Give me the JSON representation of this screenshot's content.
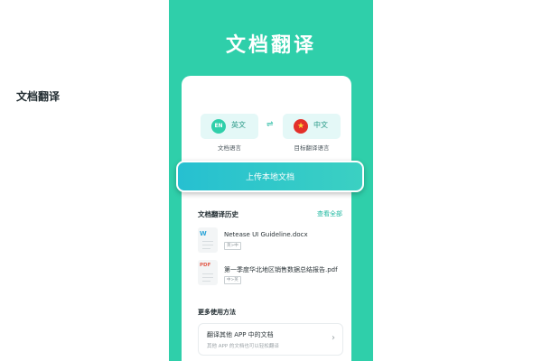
{
  "hero": {
    "title": "文档翻译"
  },
  "card": {
    "title": "文档翻译"
  },
  "source_lang": {
    "badge": "EN",
    "label": "英文",
    "caption": "文档语言"
  },
  "swap": {
    "glyph": "⇌"
  },
  "target_lang": {
    "badge": "★",
    "label": "中文",
    "caption": "目标翻译语言"
  },
  "upload": {
    "label": "上传本地文档"
  },
  "history": {
    "title": "文档翻译历史",
    "view_all": "查看全部",
    "items": [
      {
        "icon": "W",
        "name": "Netease UI Guideline.docx",
        "tag": "英>中"
      },
      {
        "icon": "PDF",
        "name": "第一季度华北地区销售数据总结报告.pdf",
        "tag": "中>英"
      }
    ]
  },
  "more": {
    "title": "更多使用方法",
    "method_title": "翻译其他 APP 中的文档",
    "method_subtitle": "其他 APP 的文档也可以轻松翻译",
    "chevron": "›"
  },
  "colors": {
    "brand": "#2fcfaa",
    "accent": "#1fb8a0",
    "pdf": "#e25a4a",
    "word": "#2fa6d8"
  }
}
